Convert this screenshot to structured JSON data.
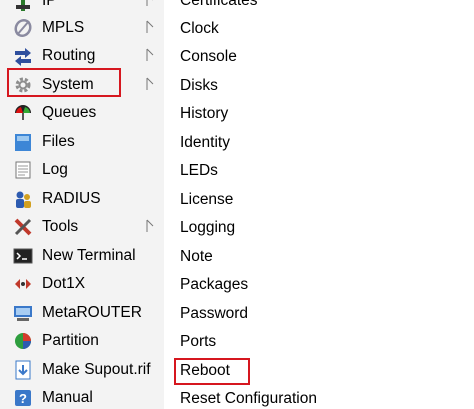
{
  "left_menu": {
    "items": [
      {
        "label": "IP",
        "icon": "ip-icon",
        "submenu": true
      },
      {
        "label": "MPLS",
        "icon": "mpls-icon",
        "submenu": true
      },
      {
        "label": "Routing",
        "icon": "routing-icon",
        "submenu": true
      },
      {
        "label": "System",
        "icon": "gear-icon",
        "submenu": true,
        "highlighted": true
      },
      {
        "label": "Queues",
        "icon": "queues-icon",
        "submenu": false
      },
      {
        "label": "Files",
        "icon": "folder-icon",
        "submenu": false
      },
      {
        "label": "Log",
        "icon": "log-icon",
        "submenu": false
      },
      {
        "label": "RADIUS",
        "icon": "radius-icon",
        "submenu": false
      },
      {
        "label": "Tools",
        "icon": "tools-icon",
        "submenu": true
      },
      {
        "label": "New Terminal",
        "icon": "terminal-icon",
        "submenu": false
      },
      {
        "label": "Dot1X",
        "icon": "dot1x-icon",
        "submenu": false
      },
      {
        "label": "MetaROUTER",
        "icon": "metarouter-icon",
        "submenu": false
      },
      {
        "label": "Partition",
        "icon": "partition-icon",
        "submenu": false
      },
      {
        "label": "Make Supout.rif",
        "icon": "supout-icon",
        "submenu": false
      },
      {
        "label": "Manual",
        "icon": "manual-icon",
        "submenu": false
      }
    ]
  },
  "submenu": {
    "items": [
      {
        "label": "Certificates"
      },
      {
        "label": "Clock"
      },
      {
        "label": "Console"
      },
      {
        "label": "Disks"
      },
      {
        "label": "History"
      },
      {
        "label": "Identity"
      },
      {
        "label": "LEDs"
      },
      {
        "label": "License"
      },
      {
        "label": "Logging"
      },
      {
        "label": "Note"
      },
      {
        "label": "Packages"
      },
      {
        "label": "Password"
      },
      {
        "label": "Ports"
      },
      {
        "label": "Reboot",
        "highlighted": true
      },
      {
        "label": "Reset Configuration"
      }
    ]
  },
  "colors": {
    "highlight": "#d6171f",
    "menu_bg": "#f3f3f3",
    "submenu_bg": "#ffffff"
  }
}
